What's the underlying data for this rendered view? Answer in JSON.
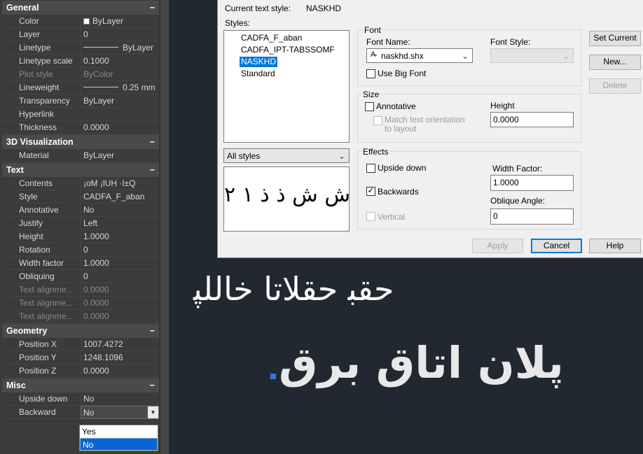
{
  "properties": {
    "sections": [
      {
        "title": "General",
        "toggle": "−",
        "rows": [
          {
            "label": "Color",
            "value": "ByLayer"
          },
          {
            "label": "Layer",
            "value": "0"
          },
          {
            "label": "Linetype",
            "value": "ByLayer"
          },
          {
            "label": "Linetype scale",
            "value": "0.1000"
          },
          {
            "label": "Plot style",
            "value": "ByColor"
          },
          {
            "label": "Lineweight",
            "value": "0.25 mm"
          },
          {
            "label": "Transparency",
            "value": "ByLayer"
          },
          {
            "label": "Hyperlink",
            "value": ""
          },
          {
            "label": "Thickness",
            "value": "0.0000"
          }
        ]
      },
      {
        "title": "3D Visualization",
        "toggle": "−",
        "rows": [
          {
            "label": "Material",
            "value": "ByLayer"
          }
        ]
      },
      {
        "title": "Text",
        "toggle": "−",
        "rows": [
          {
            "label": "Contents",
            "value": "¡oM ¡lUH ·I±Q"
          },
          {
            "label": "Style",
            "value": "CADFA_F_aban"
          },
          {
            "label": "Annotative",
            "value": "No"
          },
          {
            "label": "Justify",
            "value": "Left"
          },
          {
            "label": "Height",
            "value": "1.0000"
          },
          {
            "label": "Rotation",
            "value": "0"
          },
          {
            "label": "Width factor",
            "value": "1.0000"
          },
          {
            "label": "Obliquing",
            "value": "0"
          },
          {
            "label": "Text alignme...",
            "value": "0.0000"
          },
          {
            "label": "Text alignme...",
            "value": "0.0000"
          },
          {
            "label": "Text alignme...",
            "value": "0.0000"
          }
        ]
      },
      {
        "title": "Geometry",
        "toggle": "−",
        "rows": [
          {
            "label": "Position X",
            "value": "1007.4272"
          },
          {
            "label": "Position Y",
            "value": "1248.1096"
          },
          {
            "label": "Position Z",
            "value": "0.0000"
          }
        ]
      },
      {
        "title": "Misc",
        "toggle": "−",
        "rows": [
          {
            "label": "Upside down",
            "value": "No"
          },
          {
            "label": "Backward",
            "value": "No"
          }
        ]
      }
    ],
    "backward_dropdown": {
      "options": [
        "Yes",
        "No"
      ],
      "selected": "No"
    }
  },
  "dialog": {
    "current_style_label": "Current text style:",
    "current_style_value": "NASKHD",
    "styles_label": "Styles:",
    "styles": [
      "CADFA_F_aban",
      "CADFA_IPT-TABSSOMF",
      "NASKHD",
      "Standard"
    ],
    "selected_style": "NASKHD",
    "filter": "All styles",
    "preview_text": "ش ش ذ ذ ۱ ۲",
    "font": {
      "group": "Font",
      "font_name_label": "Font Name:",
      "font_name": "naskhd.shx",
      "font_style_label": "Font Style:",
      "font_style": "",
      "use_big_font": "Use Big Font"
    },
    "size": {
      "group": "Size",
      "annotative": "Annotative",
      "match_orientation": "Match text orientation\nto layout",
      "height_label": "Height",
      "height": "0.0000"
    },
    "effects": {
      "group": "Effects",
      "upside_down": "Upside down",
      "backwards": "Backwards",
      "vertical": "Vertical",
      "width_factor_label": "Width Factor:",
      "width_factor": "1.0000",
      "oblique_label": "Oblique Angle:",
      "oblique": "0"
    },
    "buttons": {
      "set_current": "Set Current",
      "new": "New...",
      "delete": "Delete",
      "apply": "Apply",
      "cancel": "Cancel",
      "help": "Help"
    }
  },
  "canvas": {
    "text_upper": "ﺣﻘﺒ ﺣﻘﻼﺗﺎ ﺧﺎﻟﻠﭙ",
    "text_lower": "پلان اتاق برق"
  },
  "colors": {
    "palette_bg": "#3b3b3b",
    "canvas_bg": "#212830",
    "selection_blue": "#0078d7",
    "grip_blue": "#2e78e0"
  }
}
